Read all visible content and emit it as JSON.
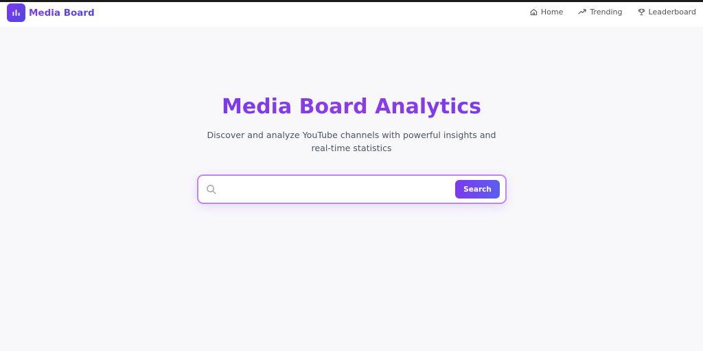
{
  "app": {
    "brand_name": "Media Board"
  },
  "nav": {
    "items": [
      {
        "label": "Home",
        "icon": "home-icon"
      },
      {
        "label": "Trending",
        "icon": "trending-up-icon"
      },
      {
        "label": "Leaderboard",
        "icon": "trophy-icon"
      }
    ]
  },
  "hero": {
    "title": "Media Board Analytics",
    "subtitle": "Discover and analyze YouTube channels with powerful insights and real-time statistics"
  },
  "search": {
    "value": "",
    "button_label": "Search"
  },
  "colors": {
    "accent": "#7c3aed",
    "accent_secondary": "#4f46e5",
    "search_border": "#c084fc",
    "background": "#f8f8fb"
  }
}
